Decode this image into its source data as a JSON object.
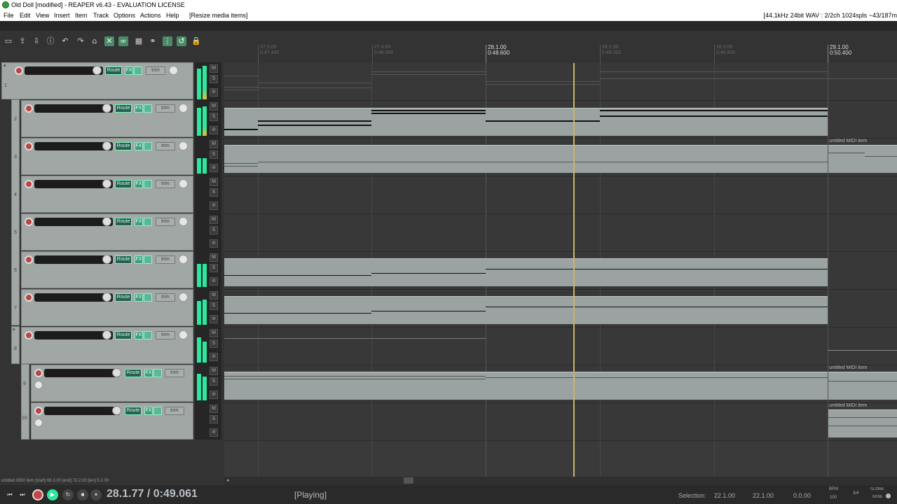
{
  "window": {
    "title": "Old Doll [modified] - REAPER v6.43 - EVALUATION LICENSE"
  },
  "menu": {
    "items": [
      "File",
      "Edit",
      "View",
      "Insert",
      "Item",
      "Track",
      "Options",
      "Actions",
      "Help",
      "[Resize media items]"
    ],
    "status": "[44.1kHz 24bit WAV : 2/2ch 1024spls ~43/187m"
  },
  "ruler": {
    "marks": [
      {
        "bar": "27.3.00",
        "time": "0:47.400",
        "major": false
      },
      {
        "bar": "27.3.00",
        "time": "0:48.000",
        "major": false
      },
      {
        "bar": "28.1.00",
        "time": "0:48.600",
        "major": true
      },
      {
        "bar": "28.2.00",
        "time": "0:49.200",
        "major": false
      },
      {
        "bar": "28.3.00",
        "time": "0:49.800",
        "major": false
      },
      {
        "bar": "29.1.00",
        "time": "0:50.400",
        "major": true
      }
    ]
  },
  "tracks": {
    "numbers": [
      "1",
      "2",
      "3",
      "4",
      "5",
      "6",
      "7",
      "8",
      "9",
      "10"
    ],
    "route_label": "Route",
    "fx_label": "FX",
    "trim_label": "trim",
    "mute_label": "M",
    "solo_label": "S",
    "phase_label": "⊘"
  },
  "items": {
    "midi_label": "untitled MIDI item"
  },
  "status_line": "untitled MIDI item [start] 66.3.00 [end] 72.2.00 [len] 5.2.00",
  "transport": {
    "position": "28.1.77 / 0:49.061",
    "state": "[Playing]",
    "selection_label": "Selection:",
    "sel_start": "22.1.00",
    "sel_end": "22.1.00",
    "sel_len": "0.0.00",
    "bpm_label": "BPM",
    "bpm": "100",
    "timesig": "3/4",
    "global_label": "GLOBAL",
    "none_label": "NONE"
  },
  "colors": {
    "accent": "#2ee6a0",
    "cursor": "#c9b56a",
    "item": "#9aa3a1"
  }
}
